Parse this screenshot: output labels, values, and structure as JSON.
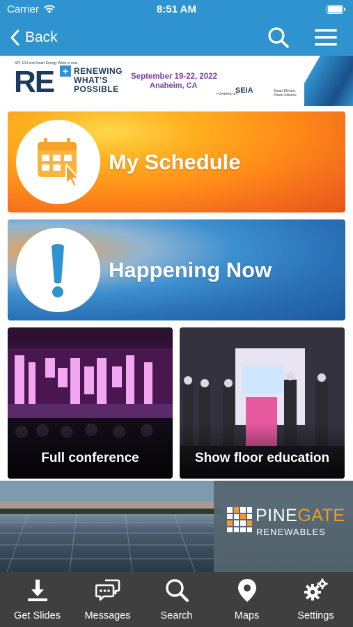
{
  "status_bar": {
    "carrier": "Carrier",
    "time": "8:51 AM"
  },
  "nav": {
    "back_label": "Back"
  },
  "banner": {
    "pretitle": "SPI, ESI and Smart Energy Week is now",
    "logo_text": "RE",
    "logo_plus": "+",
    "tagline": [
      "RENEWING",
      "WHAT'S",
      "POSSIBLE"
    ],
    "dates": "September 19-22, 2022",
    "place": "Anaheim, CA",
    "powered_by": "POWERED BY",
    "partner1": "SEIA",
    "partner2": [
      "Smart Electric",
      "Power Alliance"
    ]
  },
  "tiles": {
    "schedule": {
      "label": "My Schedule",
      "icon": "calendar-icon"
    },
    "happening": {
      "label": "Happening Now",
      "icon": "exclamation-icon"
    }
  },
  "photos": {
    "conference": {
      "caption": "Full conference"
    },
    "show_floor": {
      "caption": "Show floor education"
    }
  },
  "sponsor": {
    "brand_pine": "PINE",
    "brand_gate": "GATE",
    "brand_sub": "RENEWABLES"
  },
  "tab_bar": [
    {
      "label": "Get Slides",
      "icon": "download-icon"
    },
    {
      "label": "Messages",
      "icon": "chat-bubbles-icon"
    },
    {
      "label": "Search",
      "icon": "search-icon"
    },
    {
      "label": "Maps",
      "icon": "map-pin-icon"
    },
    {
      "label": "Settings",
      "icon": "gears-icon"
    }
  ],
  "colors": {
    "header_blue": "#2f93cf",
    "tab_bar": "#3f3f3f",
    "accent_orange": "#f29a2e"
  }
}
